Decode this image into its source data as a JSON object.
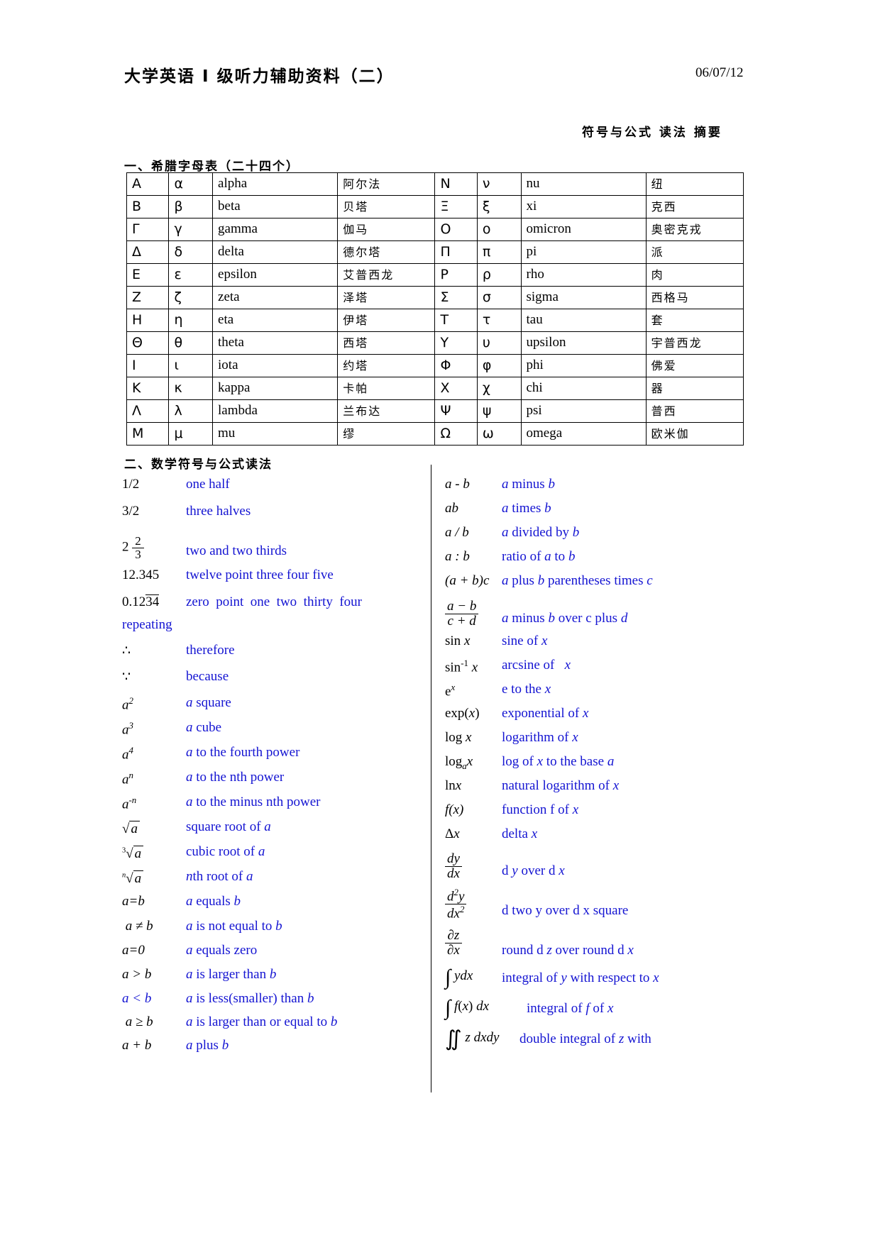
{
  "header": {
    "title": "大学英语 I 级听力辅助资料（二）",
    "date": "06/07/12",
    "subtitle": "符号与公式 读法 摘要"
  },
  "sections": {
    "greek_title": "一、希腊字母表（二十四个）",
    "math_title": "二、数学符号与公式读法"
  },
  "greek": {
    "rows": [
      {
        "cap": "A",
        "low": "α",
        "name": "alpha",
        "cn": "阿尔法",
        "cap2": "N",
        "low2": "ν",
        "name2": "nu",
        "cn2": "纽 "
      },
      {
        "cap": "B",
        "low": "β",
        "name": "beta",
        "cn": "贝塔",
        "cap2": "Ξ",
        "low2": "ξ",
        "name2": "xi",
        "cn2": "克西"
      },
      {
        "cap": "Γ",
        "low": "γ",
        "name": "gamma",
        "cn": "伽马",
        "cap2": "Ο",
        "low2": "ο",
        "name2": "omicron",
        "cn2": "奥密克戎"
      },
      {
        "cap": "Δ",
        "low": "δ",
        "name": "delta",
        "cn": "德尔塔",
        "cap2": "Π",
        "low2": "π",
        "name2": "pi",
        "cn2": "派 "
      },
      {
        "cap": "Ε",
        "low": "ε",
        "name": "epsilon",
        "cn": "艾普西龙",
        "cap2": "Ρ",
        "low2": "ρ",
        "name2": "rho",
        "cn2": "肉 "
      },
      {
        "cap": "Ζ",
        "low": "ζ",
        "name": "zeta",
        "cn": "泽塔",
        "cap2": "Σ",
        "low2": "σ",
        "name2": "sigma",
        "cn2": "西格马"
      },
      {
        "cap": "Η",
        "low": "η",
        "name": "eta",
        "cn": "伊塔",
        "cap2": "Τ",
        "low2": "τ",
        "name2": "tau",
        "cn2": "套 "
      },
      {
        "cap": "Θ",
        "low": "θ",
        "name": "theta",
        "cn": "西塔",
        "cap2": "Υ",
        "low2": "υ",
        "name2": "upsilon",
        "cn2": "宇普西龙"
      },
      {
        "cap": "Ι",
        "low": "ι",
        "name": "iota",
        "cn": "约塔",
        "cap2": "Φ",
        "low2": "φ",
        "name2": "phi",
        "cn2": "佛爱"
      },
      {
        "cap": "Κ",
        "low": "κ",
        "name": "kappa",
        "cn": "卡帕",
        "cap2": "Χ",
        "low2": "χ",
        "name2": "chi",
        "cn2": "器 "
      },
      {
        "cap": "Λ",
        "low": "λ",
        "name": "lambda",
        "cn": "兰布达",
        "cap2": "Ψ",
        "low2": "ψ",
        "name2": "psi",
        "cn2": "普西"
      },
      {
        "cap": "Μ",
        "low": "μ",
        "name": "mu",
        "cn": "缪 ",
        "cap2": "Ω",
        "low2": "ω",
        "name2": "omega",
        "cn2": "欧米伽"
      }
    ]
  },
  "left_column": [
    {
      "sym": "1/2",
      "read": "one half"
    },
    {
      "sym": "3/2",
      "read": "three halves"
    },
    {
      "sym": "2 2/3",
      "read": "two and two thirds"
    },
    {
      "sym": "12.345",
      "read": "twelve point three four five"
    },
    {
      "sym": "0.1234",
      "read": "zero point one two thirty four repeating"
    },
    {
      "sym": "∴",
      "read": "therefore"
    },
    {
      "sym": "∵",
      "read": "because"
    },
    {
      "sym": "a2",
      "read": "a square"
    },
    {
      "sym": "a3",
      "read": "a cube"
    },
    {
      "sym": "a4",
      "read": "a to the fourth power"
    },
    {
      "sym": "an",
      "read": "a to the nth power"
    },
    {
      "sym": "a-n",
      "read": "a to the minus nth power"
    },
    {
      "sym": "√a",
      "read": "square root of a"
    },
    {
      "sym": "∛a",
      "read": "cubic root of a"
    },
    {
      "sym": "ⁿ√a",
      "read": "nth root of a"
    },
    {
      "sym": "a=b",
      "read": "a equals b"
    },
    {
      "sym": "a ≠ b",
      "read": "a is not equal to b"
    },
    {
      "sym": "a=0",
      "read": "a equals zero"
    },
    {
      "sym": "a > b",
      "read": "a is larger than b"
    },
    {
      "sym": "a < b",
      "read": "a is less(smaller) than b"
    },
    {
      "sym": "a ≥ b",
      "read": "a is larger than or equal to b"
    },
    {
      "sym": "a + b",
      "read": "a plus b"
    }
  ],
  "right_column": [
    {
      "sym": "a - b",
      "read": "a minus b"
    },
    {
      "sym": "ab",
      "read": "a times b"
    },
    {
      "sym": "a / b",
      "read": "a divided by b"
    },
    {
      "sym": "a : b",
      "read": "ratio of a to b"
    },
    {
      "sym": "(a + b)c",
      "read": "a plus b parentheses times c"
    },
    {
      "sym": "(a-b)/(c+d)",
      "read": "a minus b over c plus d"
    },
    {
      "sym": "sin x",
      "read": "sine of x"
    },
    {
      "sym": "sin-1 x",
      "read": "arcsine of  x"
    },
    {
      "sym": "ex",
      "read": "e to the x"
    },
    {
      "sym": "exp(x)",
      "read": "exponential of x"
    },
    {
      "sym": "log x",
      "read": "logarithm of x"
    },
    {
      "sym": "log a x",
      "read": "log of x to the base a"
    },
    {
      "sym": "lnx",
      "read": "natural logarithm of x"
    },
    {
      "sym": "f(x)",
      "read": "function f of x"
    },
    {
      "sym": "Δx",
      "read": "delta x"
    },
    {
      "sym": "dy/dx",
      "read": "d y over d x"
    },
    {
      "sym": "d2y/dx2",
      "read": "d two y over d x square"
    },
    {
      "sym": "∂z/∂x",
      "read": "round d z over round d x"
    },
    {
      "sym": "∫ydx",
      "read": "integral of y with respect to x"
    },
    {
      "sym": "∫f(x)dx",
      "read": "integral of f of x"
    },
    {
      "sym": "∬zdxdy",
      "read": "double integral of z with"
    }
  ]
}
